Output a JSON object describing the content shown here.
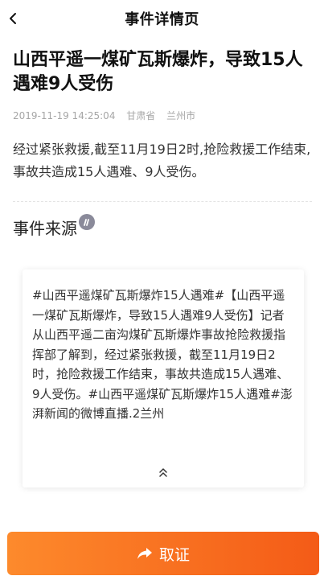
{
  "header": {
    "title": "事件详情页",
    "back_icon": "chevron-left-icon"
  },
  "article": {
    "title": "山西平遥一煤矿瓦斯爆炸，导致15人遇难9人受伤",
    "meta": {
      "datetime": "2019-11-19 14:25:04",
      "province": "甘肃省",
      "city": "兰州市"
    },
    "summary": "经过紧张救援,截至11月19日2时,抢险救援工作结束,事故共造成15人遇难、9人受伤。"
  },
  "source_section": {
    "title": "事件来源",
    "badge_icon": "source-badge-icon",
    "content": "#山西平遥煤矿瓦斯爆炸15人遇难#【山西平遥一煤矿瓦斯爆炸，导致15人遇难9人受伤】记者从山西平遥二亩沟煤矿瓦斯爆炸事故抢险救援指挥部了解到，经过紧张救援，截至11月19日2时，抢险救援工作结束，事故共造成15人遇难、9人受伤。#山西平遥煤矿瓦斯爆炸15人遇难#澎湃新闻的微博直播.2兰州",
    "collapse_icon": "double-chevron-up-icon"
  },
  "footer": {
    "button_label": "取证",
    "button_icon": "share-arrow-icon"
  },
  "colors": {
    "button_gradient_start": "#fd8a2c",
    "button_gradient_end": "#f45b17",
    "meta_text": "#a6a6a6"
  }
}
